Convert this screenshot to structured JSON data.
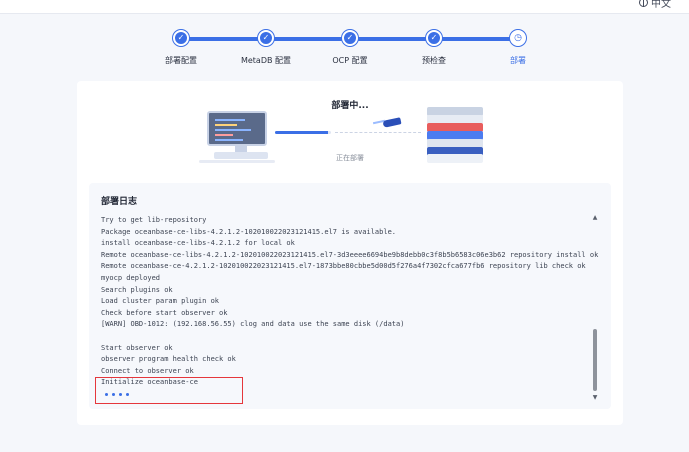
{
  "header": {
    "language_label": "中文"
  },
  "steps": [
    {
      "label": "部署配置",
      "state": "done",
      "icon": "check-icon"
    },
    {
      "label": "MetaDB 配置",
      "state": "done",
      "icon": "check-icon"
    },
    {
      "label": "OCP 配置",
      "state": "done",
      "icon": "check-icon"
    },
    {
      "label": "预检查",
      "state": "done",
      "icon": "check-icon"
    },
    {
      "label": "部署",
      "state": "current",
      "icon": "clock-icon"
    }
  ],
  "colors": {
    "accent": "#3b6fe6",
    "highlight_border": "#e5373c"
  },
  "deploy": {
    "title": "部署中...",
    "status_text": "正在部署",
    "progress_fraction": 0.95
  },
  "log": {
    "title": "部署日志",
    "lines": [
      "Try to get lib-repository",
      "Package oceanbase-ce-libs-4.2.1.2-102010022023121415.el7 is available.",
      "install oceanbase-ce-libs-4.2.1.2 for local ok",
      "Remote oceanbase-ce-libs-4.2.1.2-102010022023121415.el7-3d3eeee6694be9b8debb0c3f8b5b6583c06e3b62 repository install ok",
      "Remote oceanbase-ce-4.2.1.2-102010022023121415.el7-1873bbe80cbbe5d00d5f276a4f7302cfca677fb6 repository lib check ok",
      "myocp deployed",
      "Search plugins ok",
      "Load cluster param plugin ok",
      "Check before start observer ok",
      "[WARN] OBD-1012: (192.168.56.55) clog and data use the same disk (/data)",
      "",
      "Start observer ok",
      "observer program health check ok",
      "Connect to observer ok",
      "Initialize oceanbase-ce"
    ]
  }
}
